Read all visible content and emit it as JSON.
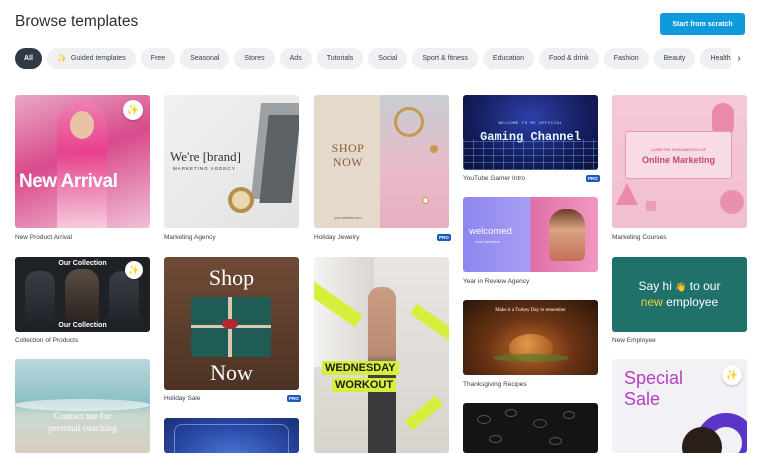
{
  "header": {
    "title": "Browse templates",
    "start_label": "Start from scratch"
  },
  "chips": [
    "All",
    "Guided templates",
    "Free",
    "Seasonal",
    "Stores",
    "Ads",
    "Tutorials",
    "Social",
    "Sport & fitness",
    "Education",
    "Food & drink",
    "Fashion",
    "Beauty",
    "Health &"
  ],
  "icons": {
    "magic": "magic-wand-icon",
    "next": "chevron-right-icon"
  },
  "badges": {
    "pro": "PRO"
  },
  "colors": {
    "accent": "#0d9bdc",
    "active_chip": "#2f3a45",
    "pro_badge": "#1d57c2"
  },
  "cards": {
    "new_product_arrival": {
      "caption": "New Product Arrival",
      "headline": "New Arrival"
    },
    "marketing_agency": {
      "caption": "Marketing Agency",
      "brand": "We're [brand]",
      "tagline": "MARKETING AGENCY"
    },
    "holiday_jewelry": {
      "caption": "Holiday Jewelry",
      "shop": "SHOP",
      "now": "NOW",
      "site": "your.website.com"
    },
    "youtube_gamer_intro": {
      "caption": "YouTube Gamer Intro",
      "welcome": "WELCOME TO MY OFFICIAL",
      "channel": "Gaming Channel"
    },
    "marketing_courses": {
      "caption": "Marketing Courses",
      "subtitle": "LEARN THE FUNDAMENTALS OF",
      "title": "Online Marketing"
    },
    "year_in_review": {
      "caption": "Year in Review Agency",
      "welcomed": "welcomed",
      "sub": "new members"
    },
    "collection_of_products": {
      "caption": "Collection of Products",
      "top": "Our Collection",
      "bottom": "Our Collection"
    },
    "holiday_sale": {
      "caption": "Holiday Sale",
      "shop": "Shop",
      "now": "Now"
    },
    "wednesday_workout": {
      "line1": "WEDNESDAY",
      "line2": "WORKOUT"
    },
    "thanksgiving_recipes": {
      "caption": "Thanksgiving Recipes",
      "banner": "Make it a Turkey Day to remember"
    },
    "new_employee": {
      "caption": "New Employee",
      "say_hi": "Say hi",
      "hand": "👋",
      "to_our": "to our",
      "new_word": "new",
      "employee": "employee"
    },
    "contact_coaching": {
      "line1": "Contact me for",
      "line2": "personal coaching"
    },
    "special_sale": {
      "line1": "Special",
      "line2": "Sale"
    }
  }
}
